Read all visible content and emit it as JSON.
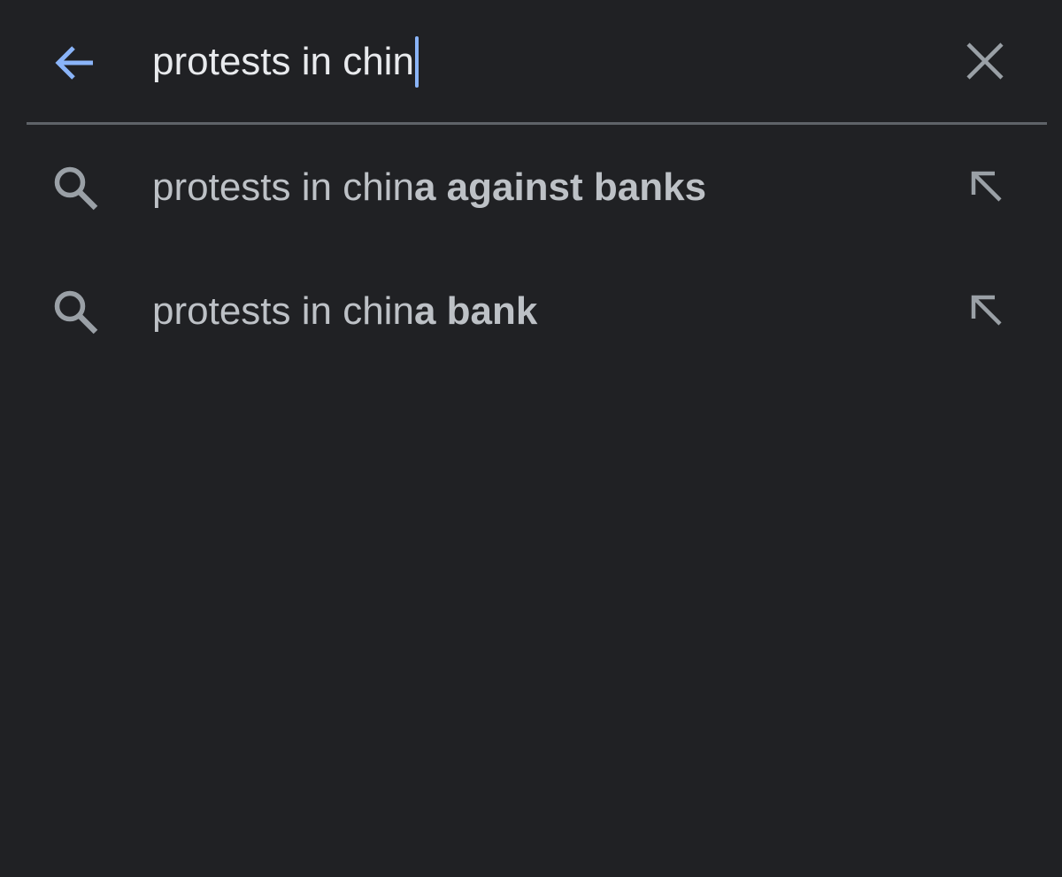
{
  "search": {
    "query": "protests in chin"
  },
  "suggestions": [
    {
      "typed": "protests in chin",
      "completion": "a against banks"
    },
    {
      "typed": "protests in chin",
      "completion": "a bank"
    }
  ],
  "icons": {
    "back": "arrow-left-icon",
    "clear": "close-icon",
    "suggestion": "search-icon",
    "fill": "arrow-up-left-icon"
  },
  "colors": {
    "background": "#202124",
    "accent": "#8ab4f8",
    "query_text": "#e8eaed",
    "suggestion_text": "#bdc1c6",
    "icon_gray": "#9aa0a6",
    "divider": "#5f6368"
  }
}
